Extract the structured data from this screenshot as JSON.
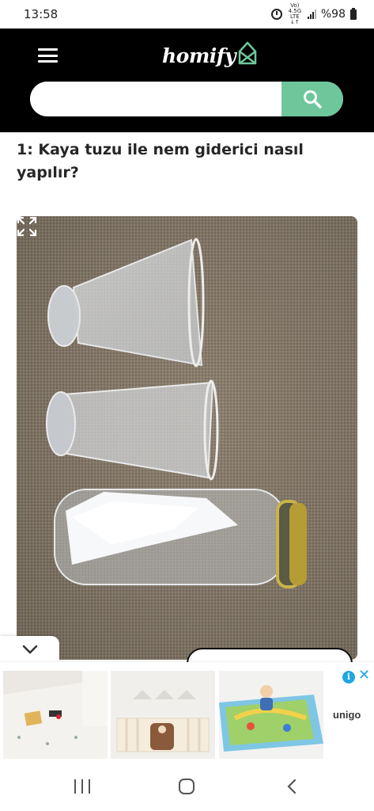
{
  "status_bar": {
    "time": "13:58",
    "network_top": "Vo) 4.5G",
    "network_bottom": "LTE ↓↑",
    "battery": "%98",
    "icons": [
      "alarm-icon",
      "network-icon",
      "signal-icon",
      "battery-icon"
    ]
  },
  "header": {
    "logo_text": "homify",
    "menu_icon": "menu-icon",
    "search": {
      "placeholder": "",
      "value": "",
      "button_icon": "search-icon"
    },
    "colors": {
      "background": "#000000",
      "accent": "#6dc79a"
    }
  },
  "article": {
    "heading": "1: Kaya tuzu ile nem giderici nasıl yapılır?",
    "photo_icon": "expand-icon"
  },
  "overlay": {
    "collapse_icon": "chevron-down-icon"
  },
  "ad": {
    "brand": "unigo",
    "icons": [
      "info-icon",
      "close-icon"
    ],
    "info_symbol": "i",
    "close_symbol": "✕"
  },
  "nav_bar": {
    "icons": [
      "recents-icon",
      "home-icon",
      "back-icon"
    ]
  }
}
